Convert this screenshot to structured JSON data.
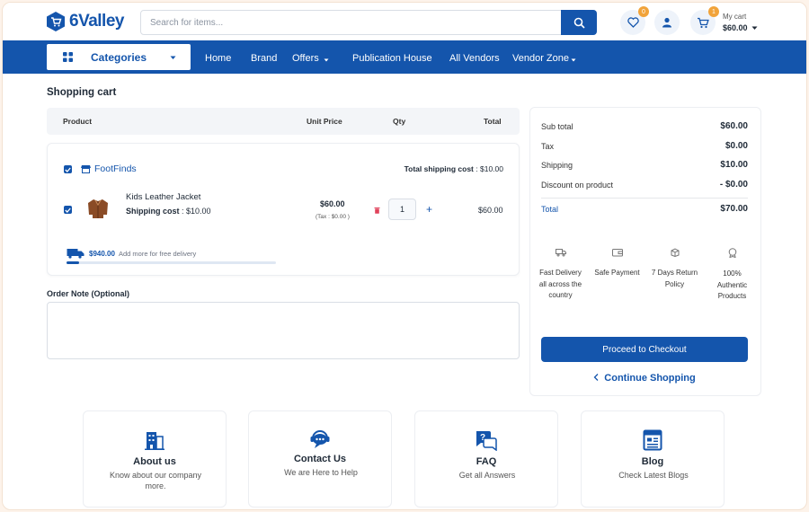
{
  "header": {
    "logo_text": "6Valley",
    "search_placeholder": "Search for items...",
    "wishlist_count": "0",
    "cart_count": "1",
    "my_cart_label": "My cart",
    "cart_total": "$60.00"
  },
  "nav": {
    "categories_label": "Categories",
    "items": [
      "Home",
      "Brand",
      "Offers",
      "Publication House",
      "All Vendors",
      "Vendor Zone"
    ]
  },
  "cart": {
    "title": "Shopping cart",
    "columns": [
      "Product",
      "Unit Price",
      "Qty",
      "Total"
    ],
    "shop_name": "FootFinds",
    "total_shipping_label": "Total shipping cost",
    "total_shipping_value": ": $10.00",
    "item": {
      "name": "Kids Leather Jacket",
      "shipping_label": "Shipping cost",
      "shipping_value": ":   $10.00",
      "unit_price": "$60.00",
      "tax": "(Tax : $0.00 )",
      "qty": "1",
      "total": "$60.00"
    },
    "free_delivery_amount": "$940.00",
    "free_delivery_text": "Add more for free delivery",
    "free_delivery_progress": 0.06,
    "order_note_label": "Order Note (Optional)"
  },
  "summary": {
    "rows": [
      {
        "label": "Sub total",
        "value": "$60.00"
      },
      {
        "label": "Tax",
        "value": "$0.00"
      },
      {
        "label": "Shipping",
        "value": "$10.00"
      },
      {
        "label": "Discount on product",
        "value": "- $0.00"
      }
    ],
    "total_label": "Total",
    "total_value": "$70.00",
    "features": [
      {
        "icon": "truck-icon",
        "label": "Fast Delivery all across the country"
      },
      {
        "icon": "wallet-icon",
        "label": "Safe Payment"
      },
      {
        "icon": "return-box-icon",
        "label": "7 Days Return Policy"
      },
      {
        "icon": "authentic-badge-icon",
        "label": "100% Authentic Products"
      }
    ],
    "checkout_label": "Proceed to Checkout",
    "continue_label": "Continue Shopping"
  },
  "info_cards": [
    {
      "icon": "building-icon",
      "title": "About us",
      "subtitle": "Know about our company more."
    },
    {
      "icon": "chat-support-icon",
      "title": "Contact Us",
      "subtitle": "We are Here to Help"
    },
    {
      "icon": "faq-icon",
      "title": "FAQ",
      "subtitle": "Get all Answers"
    },
    {
      "icon": "blog-icon",
      "title": "Blog",
      "subtitle": "Check Latest Blogs"
    }
  ],
  "colors": {
    "primary": "#1455ac",
    "badge": "#f1a33a",
    "delete": "#e0425b"
  }
}
